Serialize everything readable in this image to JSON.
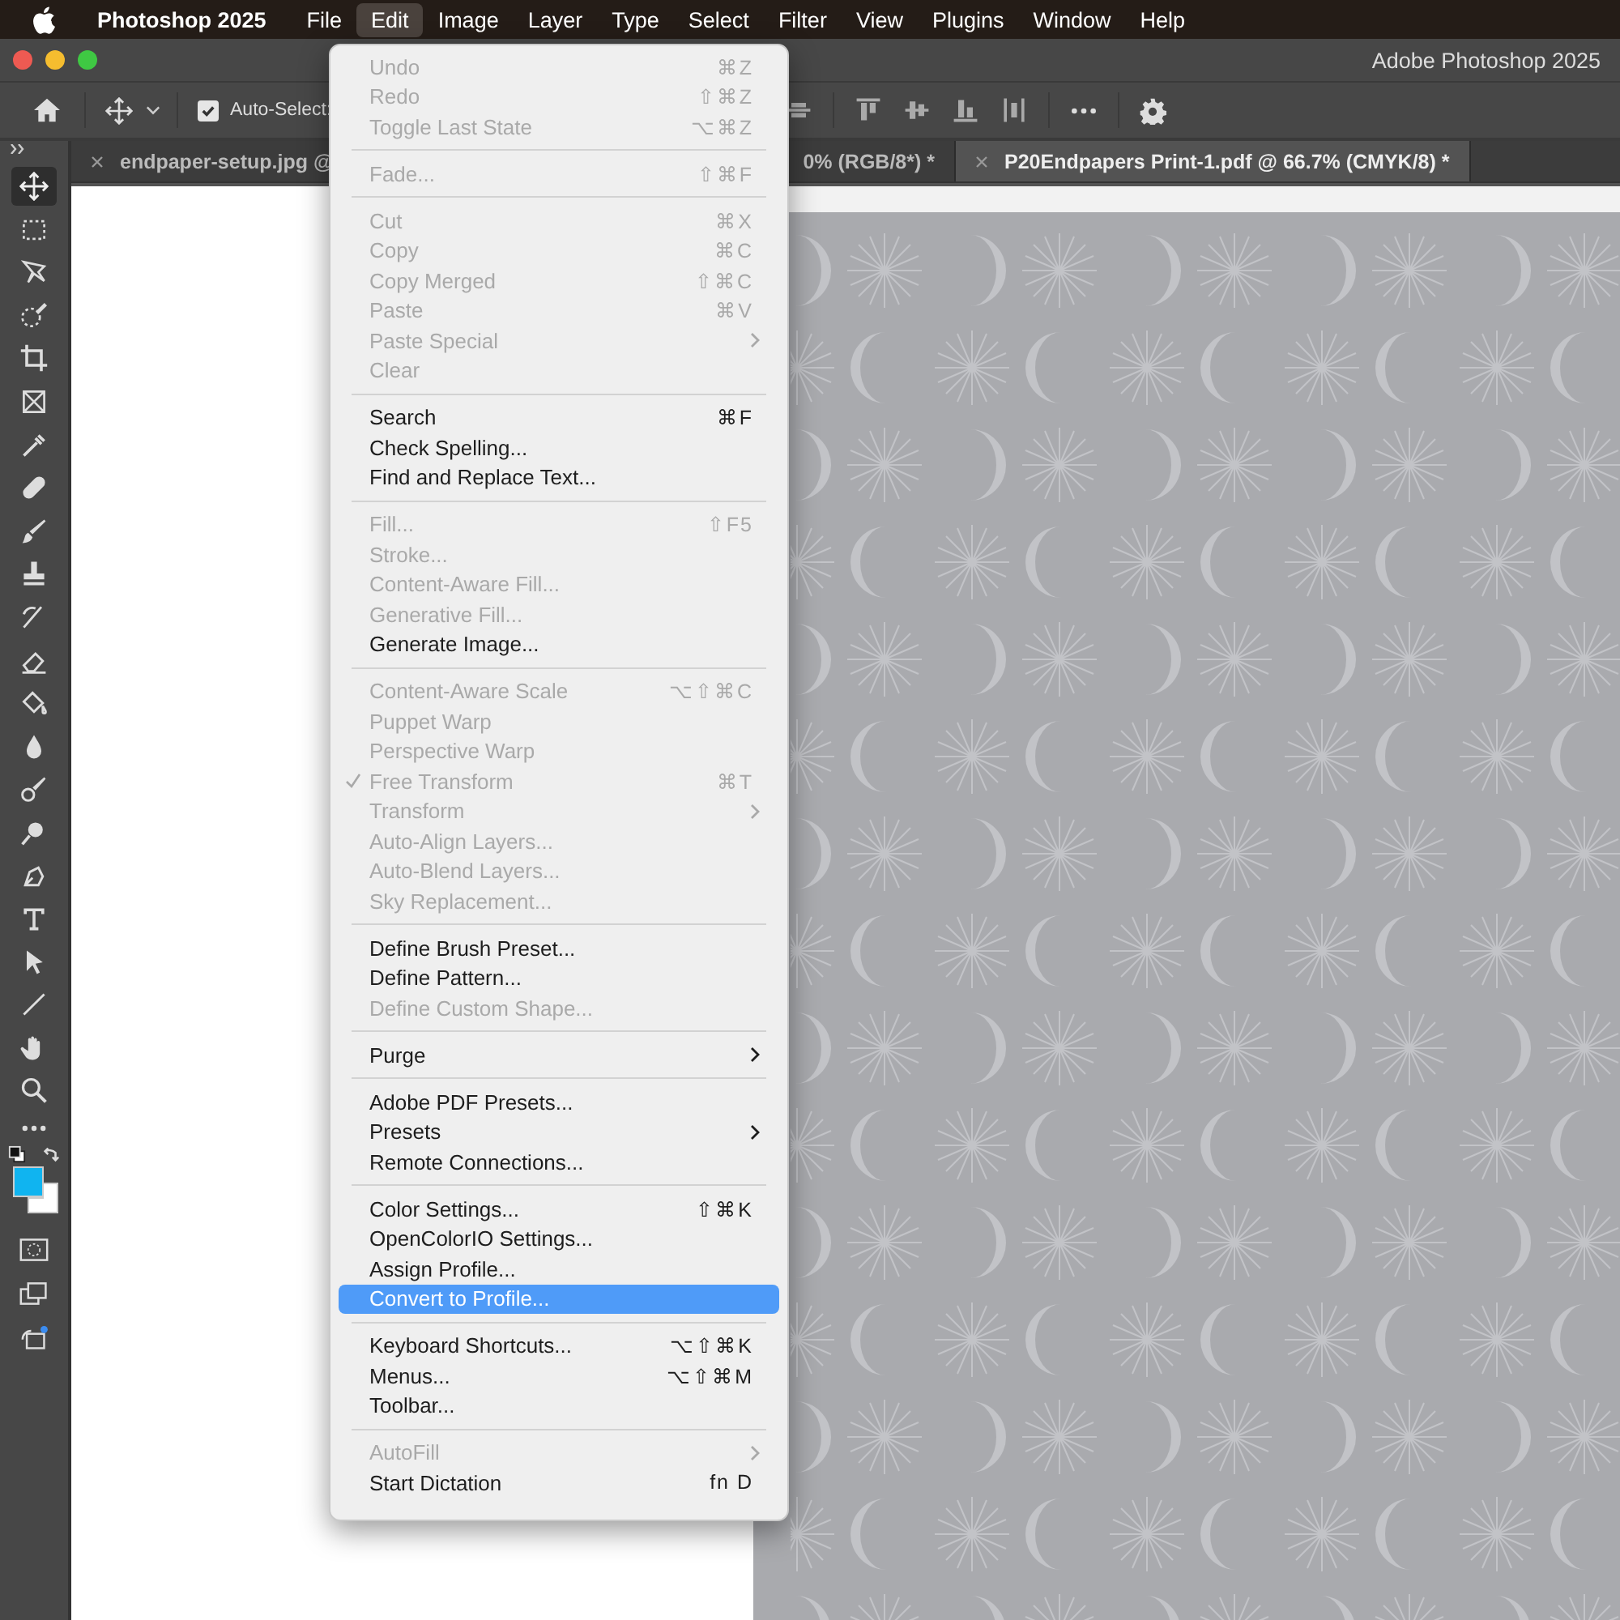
{
  "menu_bar": {
    "app_name": "Photoshop 2025",
    "items": [
      {
        "label": "File",
        "selected": false
      },
      {
        "label": "Edit",
        "selected": true
      },
      {
        "label": "Image",
        "selected": false
      },
      {
        "label": "Layer",
        "selected": false
      },
      {
        "label": "Type",
        "selected": false
      },
      {
        "label": "Select",
        "selected": false
      },
      {
        "label": "Filter",
        "selected": false
      },
      {
        "label": "View",
        "selected": false
      },
      {
        "label": "Plugins",
        "selected": false
      },
      {
        "label": "Window",
        "selected": false
      },
      {
        "label": "Help",
        "selected": false
      }
    ]
  },
  "window": {
    "title": "Adobe Photoshop 2025"
  },
  "options_bar": {
    "auto_select": {
      "label": "Auto-Select:",
      "checked": true
    }
  },
  "tabs": [
    {
      "label": "endpaper-setup.jpg @",
      "label_after_menu": "0% (RGB/8*) *",
      "selected": false
    },
    {
      "label": "P20Endpapers Print-1.pdf @ 66.7% (CMYK/8) *",
      "selected": true
    }
  ],
  "toolbar": {
    "tools": [
      {
        "selected": true
      },
      {
        "selected": false
      },
      {
        "selected": false
      },
      {
        "selected": false
      },
      {
        "selected": false
      },
      {
        "selected": false
      },
      {
        "selected": false
      },
      {
        "selected": false
      },
      {
        "selected": false
      },
      {
        "selected": false
      },
      {
        "selected": false
      },
      {
        "selected": false
      },
      {
        "selected": false
      },
      {
        "selected": false
      },
      {
        "selected": false
      },
      {
        "selected": false
      },
      {
        "selected": false
      },
      {
        "selected": false
      },
      {
        "selected": false
      },
      {
        "selected": false
      },
      {
        "selected": false
      },
      {
        "selected": false
      }
    ],
    "swatches": [
      {
        "color": "#10b4f0"
      },
      {
        "color": "#ffffff"
      }
    ]
  },
  "edit_menu": {
    "items": [
      {
        "kind": "item",
        "label": "Undo",
        "shortcut": "⌘Z",
        "disabled": true
      },
      {
        "kind": "item",
        "label": "Redo",
        "shortcut": "⇧⌘Z",
        "disabled": true
      },
      {
        "kind": "item",
        "label": "Toggle Last State",
        "shortcut": "⌥⌘Z",
        "disabled": true
      },
      {
        "kind": "separator"
      },
      {
        "kind": "item",
        "label": "Fade...",
        "shortcut": "⇧⌘F",
        "disabled": true
      },
      {
        "kind": "separator"
      },
      {
        "kind": "item",
        "label": "Cut",
        "shortcut": "⌘X",
        "disabled": true
      },
      {
        "kind": "item",
        "label": "Copy",
        "shortcut": "⌘C",
        "disabled": true
      },
      {
        "kind": "item",
        "label": "Copy Merged",
        "shortcut": "⇧⌘C",
        "disabled": true
      },
      {
        "kind": "item",
        "label": "Paste",
        "shortcut": "⌘V",
        "disabled": true
      },
      {
        "kind": "item",
        "label": "Paste Special",
        "submenu": true,
        "disabled": true
      },
      {
        "kind": "item",
        "label": "Clear",
        "disabled": true
      },
      {
        "kind": "separator"
      },
      {
        "kind": "item",
        "label": "Search",
        "shortcut": "⌘F",
        "disabled": false
      },
      {
        "kind": "item",
        "label": "Check Spelling...",
        "disabled": false
      },
      {
        "kind": "item",
        "label": "Find and Replace Text...",
        "disabled": false
      },
      {
        "kind": "separator"
      },
      {
        "kind": "item",
        "label": "Fill...",
        "shortcut": "⇧F5",
        "disabled": true
      },
      {
        "kind": "item",
        "label": "Stroke...",
        "disabled": true
      },
      {
        "kind": "item",
        "label": "Content-Aware Fill...",
        "disabled": true
      },
      {
        "kind": "item",
        "label": "Generative Fill...",
        "disabled": true
      },
      {
        "kind": "item",
        "label": "Generate Image...",
        "disabled": false
      },
      {
        "kind": "separator"
      },
      {
        "kind": "item",
        "label": "Content-Aware Scale",
        "shortcut": "⌥⇧⌘C",
        "disabled": true
      },
      {
        "kind": "item",
        "label": "Puppet Warp",
        "disabled": true
      },
      {
        "kind": "item",
        "label": "Perspective Warp",
        "disabled": true
      },
      {
        "kind": "item",
        "label": "Free Transform",
        "shortcut": "⌘T",
        "disabled": true,
        "checked": true
      },
      {
        "kind": "item",
        "label": "Transform",
        "submenu": true,
        "disabled": true
      },
      {
        "kind": "item",
        "label": "Auto-Align Layers...",
        "disabled": true
      },
      {
        "kind": "item",
        "label": "Auto-Blend Layers...",
        "disabled": true
      },
      {
        "kind": "item",
        "label": "Sky Replacement...",
        "disabled": true
      },
      {
        "kind": "separator"
      },
      {
        "kind": "item",
        "label": "Define Brush Preset...",
        "disabled": false
      },
      {
        "kind": "item",
        "label": "Define Pattern...",
        "disabled": false
      },
      {
        "kind": "item",
        "label": "Define Custom Shape...",
        "disabled": true
      },
      {
        "kind": "separator"
      },
      {
        "kind": "item",
        "label": "Purge",
        "submenu": true,
        "disabled": false
      },
      {
        "kind": "separator"
      },
      {
        "kind": "item",
        "label": "Adobe PDF Presets...",
        "disabled": false
      },
      {
        "kind": "item",
        "label": "Presets",
        "submenu": true,
        "disabled": false
      },
      {
        "kind": "item",
        "label": "Remote Connections...",
        "disabled": false
      },
      {
        "kind": "separator"
      },
      {
        "kind": "item",
        "label": "Color Settings...",
        "shortcut": "⇧⌘K",
        "disabled": false
      },
      {
        "kind": "item",
        "label": "OpenColorIO Settings...",
        "disabled": false
      },
      {
        "kind": "item",
        "label": "Assign Profile...",
        "disabled": false
      },
      {
        "kind": "item",
        "label": "Convert to Profile...",
        "disabled": false,
        "selected": true
      },
      {
        "kind": "separator"
      },
      {
        "kind": "item",
        "label": "Keyboard Shortcuts...",
        "shortcut": "⌥⇧⌘K",
        "disabled": false
      },
      {
        "kind": "item",
        "label": "Menus...",
        "shortcut": "⌥⇧⌘M",
        "disabled": false
      },
      {
        "kind": "item",
        "label": "Toolbar...",
        "disabled": false
      },
      {
        "kind": "separator"
      },
      {
        "kind": "item",
        "label": "AutoFill",
        "submenu": true,
        "disabled": true
      },
      {
        "kind": "item",
        "label": "Start Dictation",
        "shortcut": "fn D",
        "disabled": false
      }
    ]
  }
}
